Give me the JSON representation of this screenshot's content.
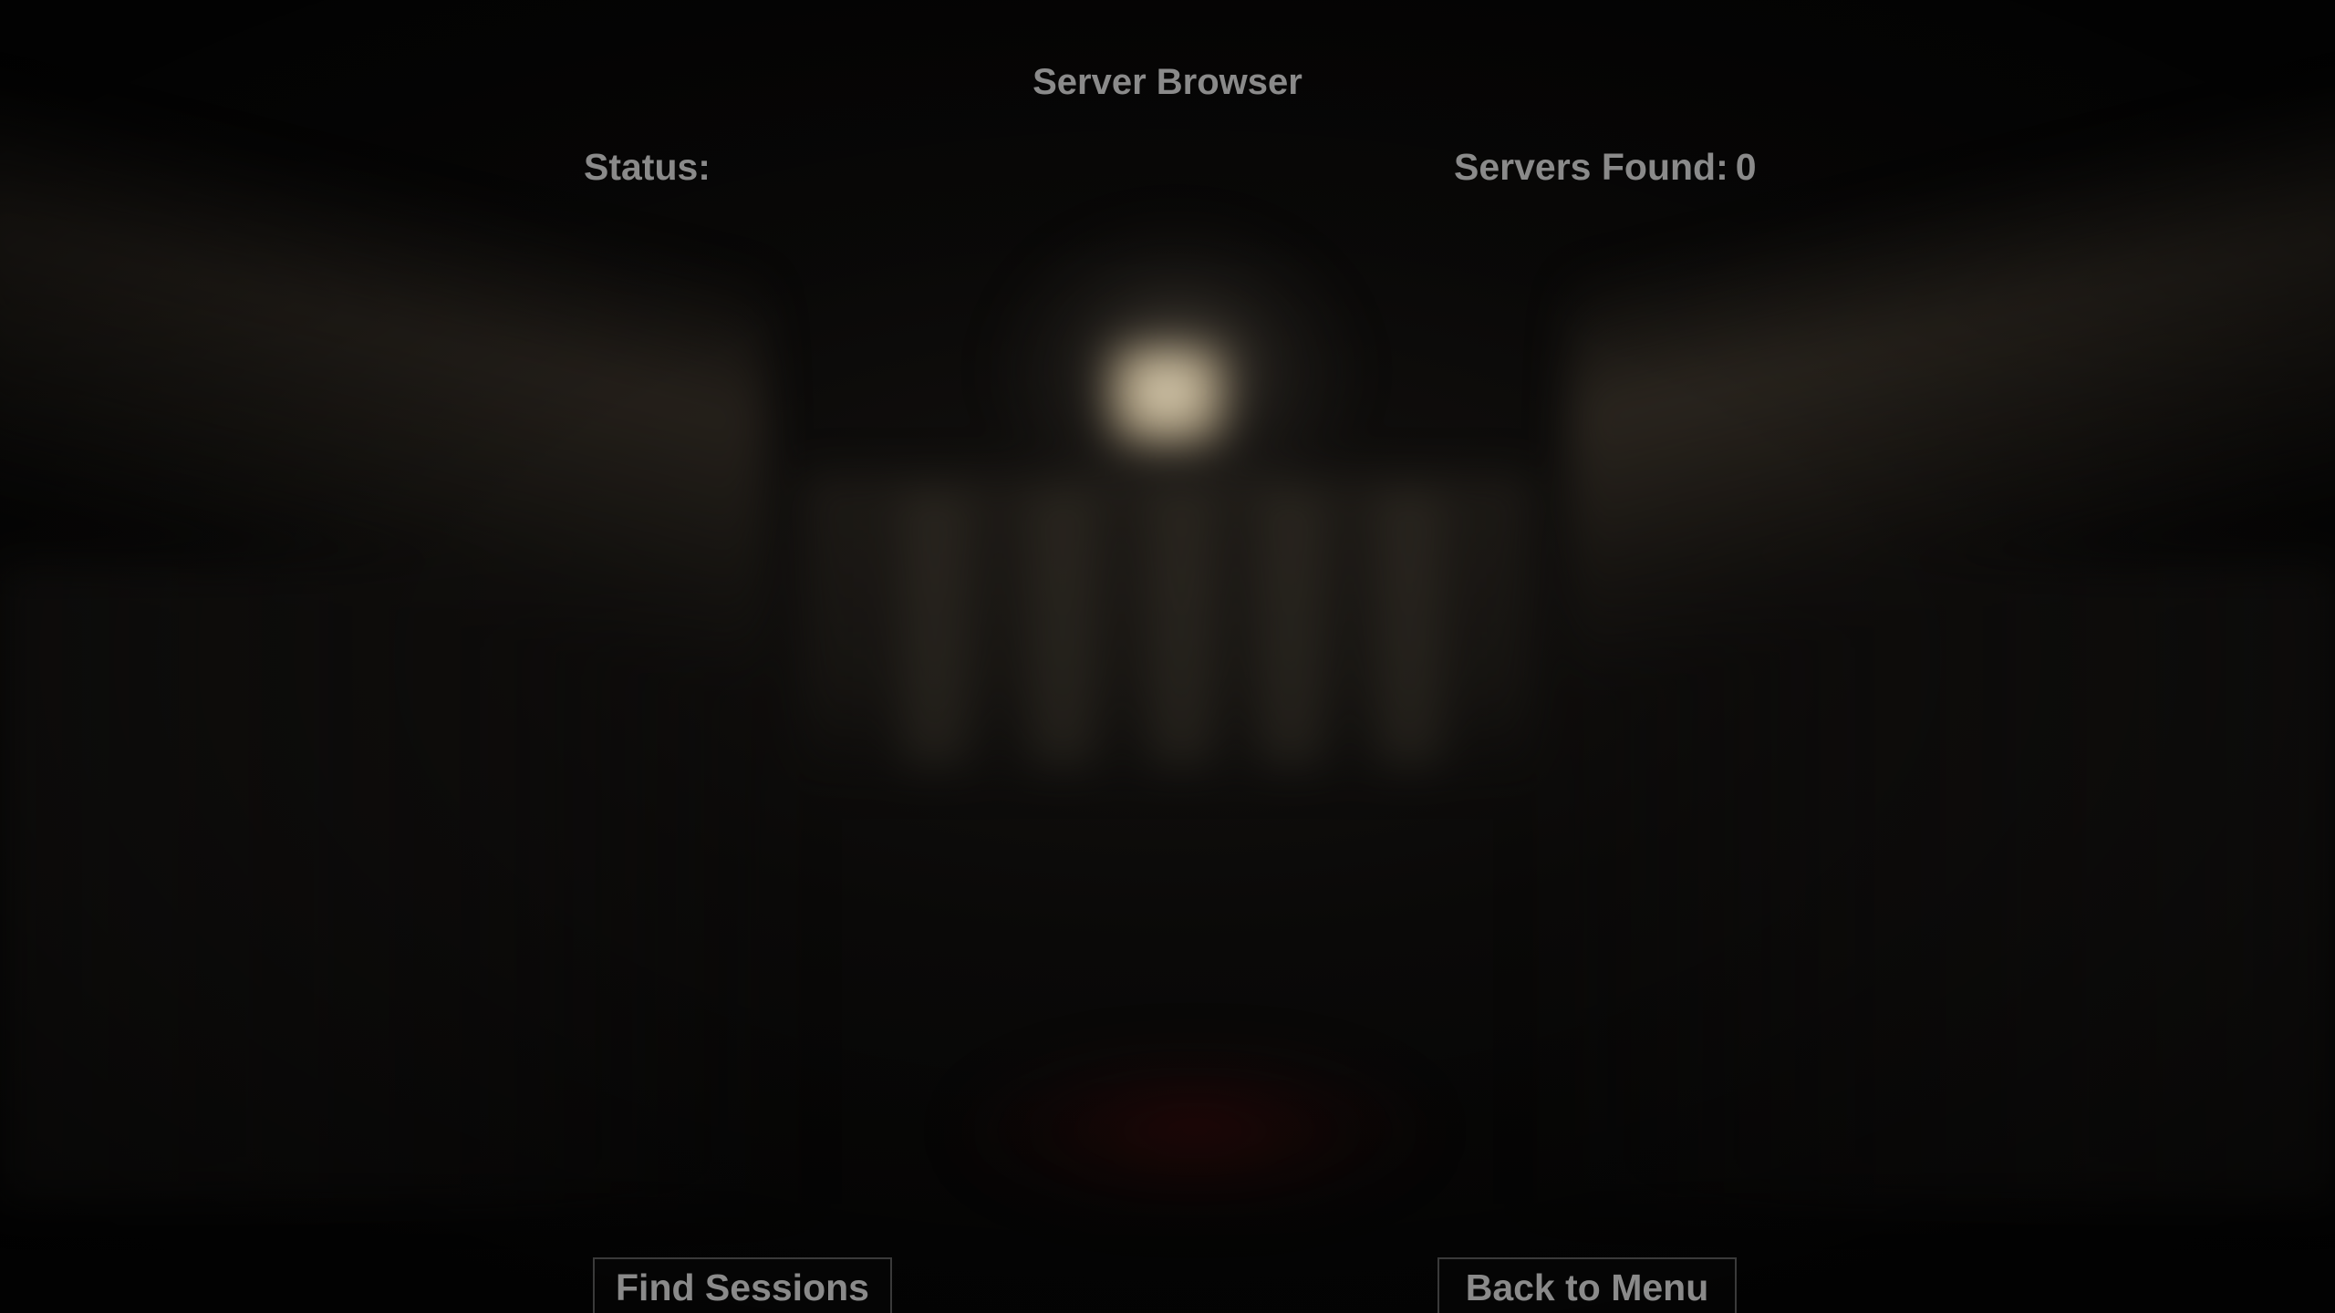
{
  "screen": {
    "title": "Server Browser",
    "status_label": "Status:",
    "status_value": "",
    "servers_found_label": "Servers Found:",
    "servers_found_count": "0"
  },
  "buttons": {
    "find_sessions": "Find Sessions",
    "back_to_menu": "Back to Menu"
  },
  "colors": {
    "text": "#8a8a8a",
    "button_border": "#3a3a3a",
    "background": "#050505"
  }
}
